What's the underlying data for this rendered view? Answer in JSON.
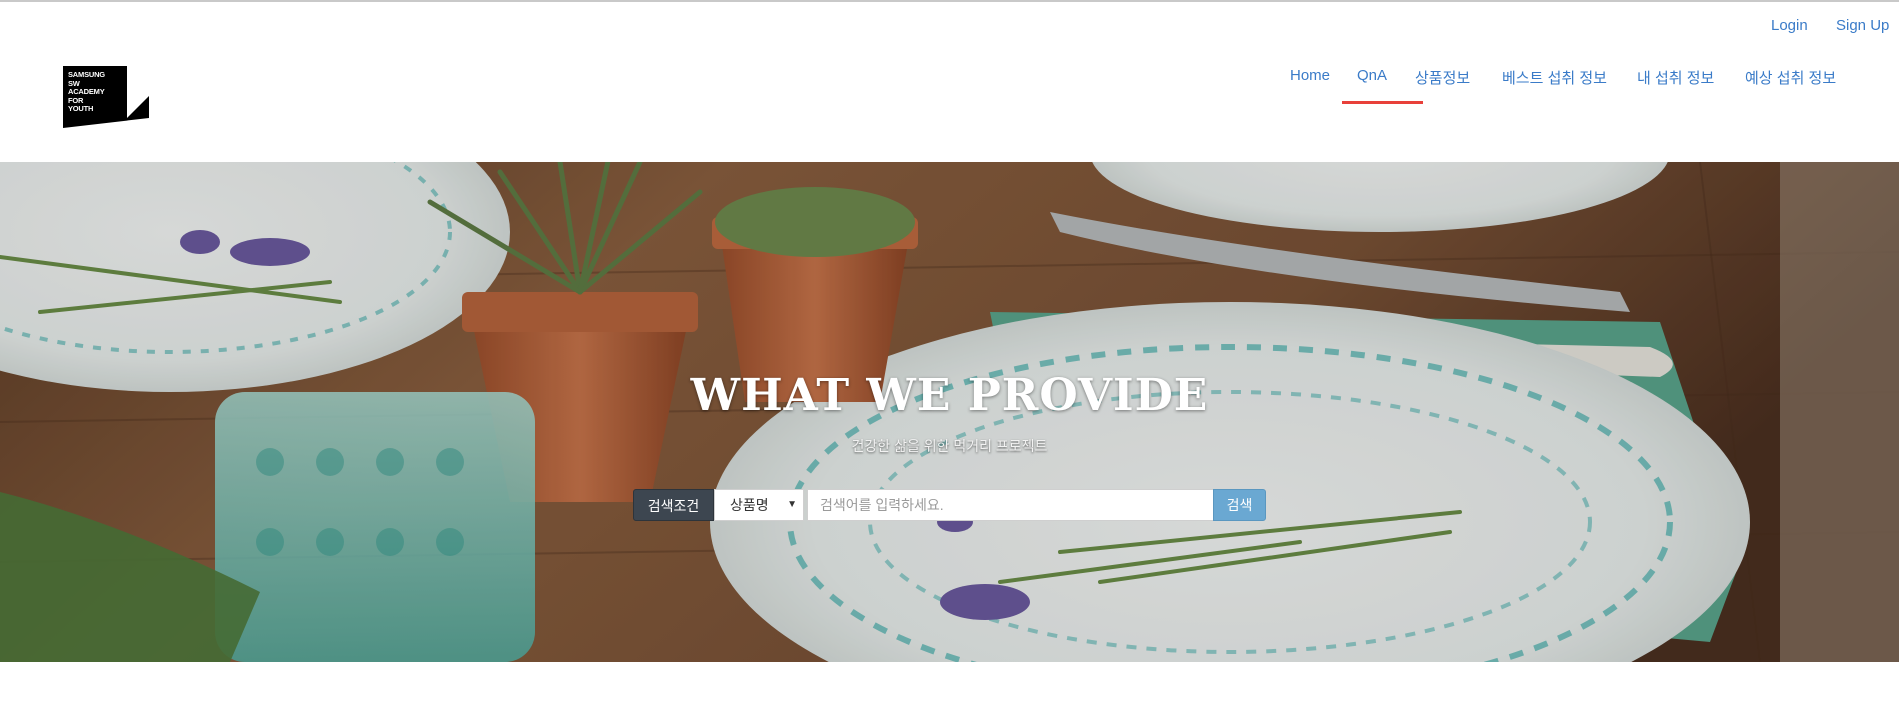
{
  "header": {
    "auth": {
      "login": "Login",
      "signup": "Sign Up"
    },
    "logo": {
      "lines": [
        "SAMSUNG",
        "SW",
        "ACADEMY",
        "FOR",
        "YOUTH"
      ]
    },
    "nav": {
      "items": [
        {
          "label": "Home"
        },
        {
          "label": "QnA",
          "active": true
        },
        {
          "label": "상품정보"
        },
        {
          "label": "베스트 섭취 정보"
        },
        {
          "label": "내 섭취 정보"
        },
        {
          "label": "예상 섭취 정보"
        }
      ]
    },
    "colors": {
      "link": "#3a7bc8",
      "active_underline": "#e8403a"
    }
  },
  "hero": {
    "title": "WHAT WE PROVIDE",
    "subtitle": "건강한 삶을 위한 먹거리 프로젝트",
    "search": {
      "label": "검색조건",
      "select_value": "상품명",
      "placeholder": "검색어를 입력하세요.",
      "value": "",
      "button": "검색"
    },
    "colors": {
      "label_bg": "#3d4650",
      "button_bg": "#6aa8d2"
    }
  }
}
